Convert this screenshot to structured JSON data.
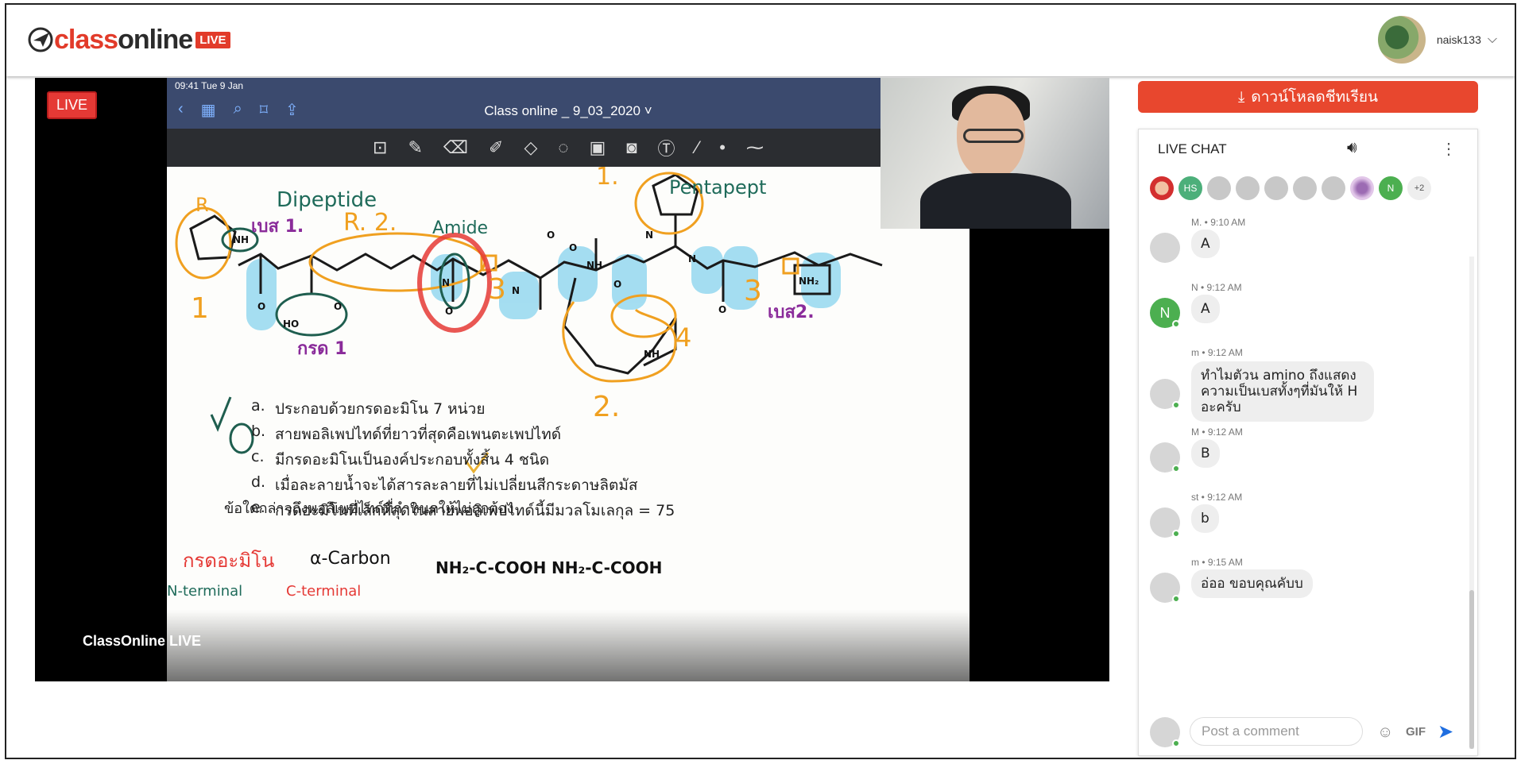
{
  "header": {
    "logo_class": "class",
    "logo_online": "online",
    "logo_live": "LIVE",
    "username": "naisk133"
  },
  "video": {
    "live_badge": "LIVE",
    "caption": "ClassOnline LIVE",
    "ipad_status": "09:41  Tue 9 Jan",
    "doc_title": "Class online _ 9_03_2020 ˅",
    "question": "ข้อใดกล่าวถึงพอลิเพปไทด์ที่กำหนดให้ไม่ถูกต้อง",
    "options": [
      {
        "letter": "a.",
        "text": "ประกอบด้วยกรดอะมิโน 7 หน่วย"
      },
      {
        "letter": "b.",
        "text": "สายพอลิเพปไทด์ที่ยาวที่สุดคือเพนตะเพปไทด์"
      },
      {
        "letter": "c.",
        "text": "มีกรดอะมิโนเป็นองค์ประกอบทั้งสิ้น 4 ชนิด"
      },
      {
        "letter": "d.",
        "text": "เมื่อละลายน้ำจะได้สารละลายที่ไม่เปลี่ยนสีกระดาษลิตมัส"
      },
      {
        "letter": "e.",
        "text": "กรดอะมิโนที่เล็กที่สุดในสายพอลิเพปไทด์นี้มีมวลโมเลกุล = 75"
      }
    ],
    "handwriting": {
      "dipeptide": "Dipeptide",
      "pentapeptide": "Pentapept",
      "amide": "Amide",
      "base1": "เบส 1.",
      "base2": "เบส2.",
      "acid1": "กรด 1",
      "r": "R",
      "r2": "R. 2.",
      "alpha_carbon": "α-Carbon",
      "n_terminal": "N-terminal",
      "c_terminal": "C-terminal",
      "amino": "กรดอะมิโน",
      "formula1": "NH₂-C-COOH",
      "formula2": "NH₂-C-COOH",
      "n1": "1",
      "n2": "2.",
      "n3": "3",
      "n4": "4",
      "top1": "1."
    }
  },
  "download_button": "ดาวน์โหลดชีทเรียน",
  "chat": {
    "title": "LIVE CHAT",
    "viewers_more": "+2",
    "viewer_hs": "HS",
    "viewer_n": "N",
    "messages": [
      {
        "name": "M.",
        "time": "9:10 AM",
        "text": "A"
      },
      {
        "name": "N",
        "time": "9:12 AM",
        "text": "A",
        "avatar_letter": "N"
      },
      {
        "name": "m",
        "time": "9:12 AM",
        "text": "ทำไมตัวน amino ถึงแสดงความเป็นเบสทั้งๆที่มันให้ H อะครับ"
      },
      {
        "name": "M",
        "time": "9:12 AM",
        "text": "B"
      },
      {
        "name": "st",
        "time": "9:12 AM",
        "text": "b"
      },
      {
        "name": "m",
        "time": "9:15 AM",
        "text": "อ่ออ ขอบคุณคับบ"
      }
    ],
    "input_placeholder": "Post a comment",
    "gif_label": "GIF"
  }
}
